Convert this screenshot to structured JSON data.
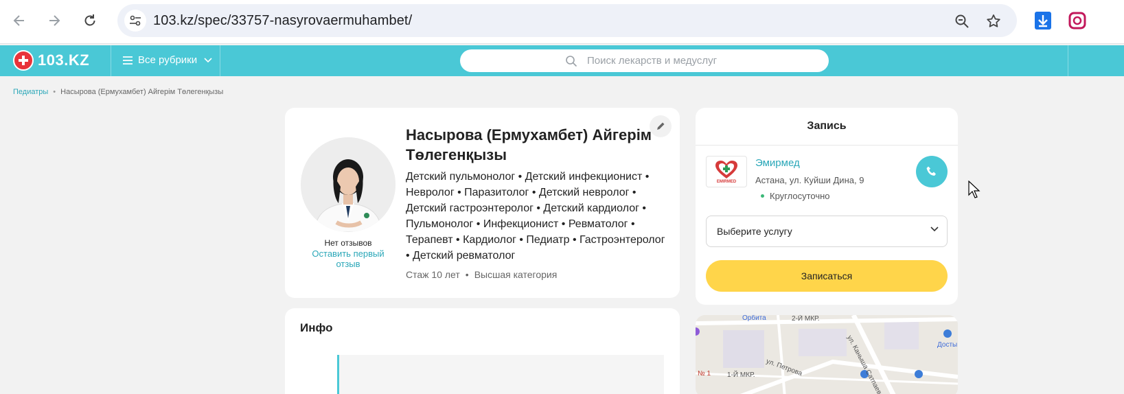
{
  "browser": {
    "url": "103.kz/spec/33757-nasyrovaermuhambet/",
    "icons": [
      "back-icon",
      "forward-icon",
      "reload-icon",
      "site-info-icon",
      "zoom-icon",
      "bookmark-star-icon",
      "download-icon",
      "extension-icon"
    ]
  },
  "header": {
    "logo_text": "103.KZ",
    "rubrics_label": "Все рубрики",
    "search_placeholder": "Поиск лекарств и медуслуг",
    "brand_color": "#4ac8d6"
  },
  "breadcrumb": {
    "category": "Педиатры",
    "current": "Насырова (Ермухамбет) Айгерім Төлегенқызы"
  },
  "doctor": {
    "name_line1": "Насырова (Ермухамбет) Айгерім",
    "name_line2": "Төлегенқызы",
    "specialties": "Детский пульмонолог • Детский инфекционист • Невролог • Паразитолог • Детский невролог • Детский гастроэнтеролог • Детский кардиолог • Пульмонолог • Инфекционист • Ревматолог • Терапевт • Кардиолог • Педиатр • Гастроэнтеролог • Детский ревматолог",
    "experience": "Стаж 10 лет",
    "category": "Высшая категория",
    "no_reviews": "Нет отзывов",
    "leave_review": "Оставить первый отзыв"
  },
  "info": {
    "title": "Инфо"
  },
  "booking": {
    "title": "Запись",
    "clinic_logo_text": "EMIRMED",
    "clinic_name": "Эмирмед",
    "clinic_address": "Астана, ул. Куйши Дина, 9",
    "clinic_hours": "Круглосуточно",
    "service_placeholder": "Выберите услугу",
    "book_button": "Записаться",
    "accent_color": "#ffd54a"
  },
  "map": {
    "labels": {
      "orbita": "Орбита",
      "mkr2": "2-Й МКР.",
      "kanysha": "ул. Каныша Сатпаева",
      "petrova": "ул. Петрова",
      "mkr1": "1-Й МКР.",
      "dosty": "Досты",
      "no1": "№ 1"
    }
  }
}
